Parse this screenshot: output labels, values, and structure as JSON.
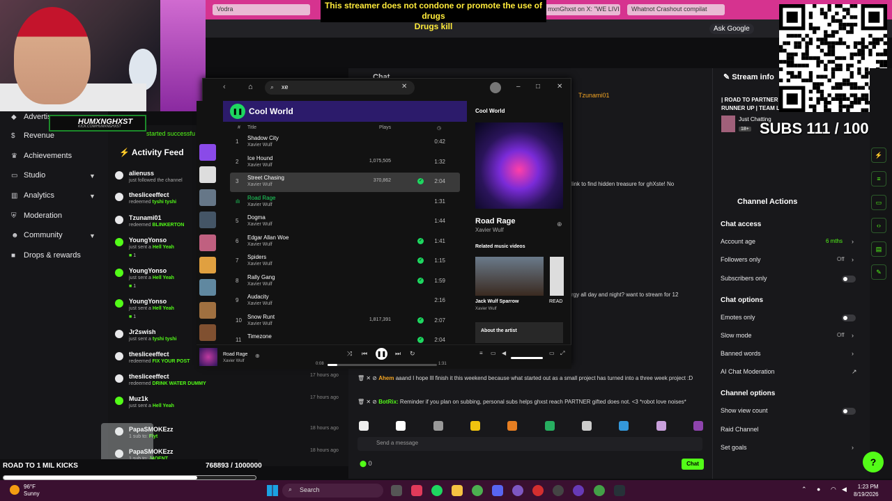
{
  "browser": {
    "tabs": [
      "Vodra",
      "mxnGhxst on X: \"WE LIVI",
      "Whatnot Crashout compilat"
    ],
    "ask_google": "Ask Google"
  },
  "overlay": {
    "warning_line1": "This streamer does not condone or promote the use of drugs",
    "warning_line2": "Drugs kill",
    "cam_tag": "HUMXNGHXST",
    "cam_tag_sub": "KICK.COM/HUMXNGHXST",
    "road_label": "ROAD TO 1 MIL KICKS",
    "road_value": "768893 / 1000000",
    "road_progress": 0.768893,
    "subs_goal": "SUBS 111 / 100"
  },
  "left_nav": {
    "items": [
      {
        "label": "Advertis",
        "icon": "megaphone-icon"
      },
      {
        "label": "Revenue",
        "icon": "dollar-icon"
      },
      {
        "label": "Achievements",
        "icon": "trophy-icon"
      },
      {
        "label": "Studio",
        "icon": "monitor-icon"
      },
      {
        "label": "Analytics",
        "icon": "chart-icon"
      },
      {
        "label": "Moderation",
        "icon": "shield-icon"
      },
      {
        "label": "Community",
        "icon": "people-icon"
      },
      {
        "label": "Drops & rewards",
        "icon": "gift-icon"
      }
    ],
    "started_text": "started successfu"
  },
  "activity_feed": {
    "title": "Activity Feed",
    "items": [
      {
        "name": "alienuss",
        "action": "just followed the channel",
        "bold": "",
        "time": "",
        "count": ""
      },
      {
        "name": "thesliceeffect",
        "action": "redeemed",
        "bold": "tyshi tyshi",
        "time": "",
        "count": ""
      },
      {
        "name": "Tzunami01",
        "action": "redeemed",
        "bold": "BLINKERTON",
        "time": "",
        "count": ""
      },
      {
        "name": "YoungYonso",
        "action": "just sent a",
        "bold": "Hell Yeah",
        "time": "",
        "count": "1"
      },
      {
        "name": "YoungYonso",
        "action": "just sent a",
        "bold": "Hell Yeah",
        "time": "",
        "count": "1"
      },
      {
        "name": "YoungYonso",
        "action": "just sent a",
        "bold": "Hell Yeah",
        "time": "",
        "count": "1"
      },
      {
        "name": "Jr2swish",
        "action": "just sent a",
        "bold": "tyshi tyshi",
        "time": "",
        "count": ""
      },
      {
        "name": "thesliceeffect",
        "action": "redeemed",
        "bold": "FIX YOUR POST",
        "time": "",
        "count": ""
      },
      {
        "name": "thesliceeffect",
        "action": "redeemed",
        "bold": "DRINK WATER DUMMY",
        "time": "17 hours ago",
        "count": ""
      },
      {
        "name": "Muz1k",
        "action": "just sent a",
        "bold": "Hell Yeah",
        "time": "17 hours ago",
        "count": ""
      },
      {
        "name": "PapaSMOKEzz",
        "action": "1 sub to:",
        "bold": "Flyt",
        "time": "18 hours ago",
        "count": ""
      },
      {
        "name": "PapaSMOKEzz",
        "action": "1 sub to:",
        "bold": "J4OENT",
        "time": "18 hours ago",
        "count": ""
      }
    ]
  },
  "chat": {
    "title": "Chat",
    "tzunami": "Tzunami01",
    "stray1": "link to find hidden treasure for ghXste! No",
    "stray2": "rgy all day and night? want to stream for 12",
    "messages": [
      {
        "user": "Ahem",
        "text": "aaand I hope Ill finish it this weekend because what started out as a small project has turned into a three week project :D"
      },
      {
        "user": "BotRix:",
        "text": "Reminder if you plan on subbing, personal subs helps ghxst reach PARTNER gifted does not. <3 *robot love noises*"
      }
    ],
    "input_placeholder": "Send a message",
    "points": "0",
    "send_label": "Chat"
  },
  "stream_info": {
    "title": "Stream info",
    "stream_title": "| ROAD TO PARTNER | RUNNER UP | TEAM L",
    "category": "Just Chatting",
    "badge": "18+"
  },
  "channel_actions": {
    "title": "Channel Actions",
    "chat_access_header": "Chat access",
    "account_age_label": "Account age",
    "account_age_value": "6 mths",
    "followers_only_label": "Followers only",
    "followers_only_value": "Off",
    "subscribers_only_label": "Subscribers only",
    "chat_options_header": "Chat options",
    "emotes_only_label": "Emotes only",
    "slow_mode_label": "Slow mode",
    "slow_mode_value": "Off",
    "banned_words_label": "Banned words",
    "ai_moderation_label": "AI Chat Moderation",
    "channel_options_header": "Channel options",
    "view_count_label": "Show view count",
    "raid_label": "Raid Channel",
    "goals_label": "Set goals"
  },
  "spotify": {
    "search_value": "xe",
    "playlist": "Cool World",
    "col_title": "Title",
    "col_plays": "Plays",
    "tracks": [
      {
        "no": "1",
        "title": "Shadow City",
        "artist": "Xavier Wulf",
        "plays": "",
        "saved": false,
        "dur": "0:42"
      },
      {
        "no": "2",
        "title": "Ice Hound",
        "artist": "Xavier Wulf",
        "plays": "1,075,505",
        "saved": false,
        "dur": "1:32"
      },
      {
        "no": "3",
        "title": "Street Chasing",
        "artist": "Xavier Wulf",
        "plays": "370,862",
        "saved": true,
        "dur": "2:04"
      },
      {
        "no": "4",
        "title": "Road Rage",
        "artist": "Xavier Wulf",
        "plays": "",
        "saved": false,
        "dur": "1:31"
      },
      {
        "no": "5",
        "title": "Dogma",
        "artist": "Xavier Wulf",
        "plays": "",
        "saved": false,
        "dur": "1:44"
      },
      {
        "no": "6",
        "title": "Edgar Allan Woe",
        "artist": "Xavier Wulf",
        "plays": "",
        "saved": true,
        "dur": "1:41"
      },
      {
        "no": "7",
        "title": "Spiders",
        "artist": "Xavier Wulf",
        "plays": "",
        "saved": true,
        "dur": "1:15"
      },
      {
        "no": "8",
        "title": "Rally Gang",
        "artist": "Xavier Wulf",
        "plays": "",
        "saved": true,
        "dur": "1:59"
      },
      {
        "no": "9",
        "title": "Audacity",
        "artist": "Xavier Wulf",
        "plays": "",
        "saved": false,
        "dur": "2:16"
      },
      {
        "no": "10",
        "title": "Snow Runt",
        "artist": "Xavier Wulf",
        "plays": "1,817,391",
        "saved": true,
        "dur": "2:07"
      },
      {
        "no": "11",
        "title": "Timezone",
        "artist": "",
        "plays": "",
        "saved": true,
        "dur": "2:04"
      }
    ],
    "now_playing_header": "Cool World",
    "now_playing_title": "Road Rage",
    "now_playing_artist": "Xavier Wulf",
    "related_header": "Related music videos",
    "related1_title": "Jack Wulf Sparrow",
    "related1_artist": "Xavier Wulf",
    "related2_title": "READ",
    "about_artist": "About the artist",
    "player_title": "Road Rage",
    "player_artist": "Xavier Wulf",
    "elapsed": "0:08",
    "total": "1:31",
    "progress": 0.088
  },
  "taskbar": {
    "temp": "96°F",
    "weather": "Sunny",
    "search": "Search",
    "time": "1:23 PM",
    "date": "8/19/2026"
  },
  "colors": {
    "kick_green": "#53fc18",
    "spotify_green": "#1ed760",
    "browser_pink": "#d6338f"
  }
}
